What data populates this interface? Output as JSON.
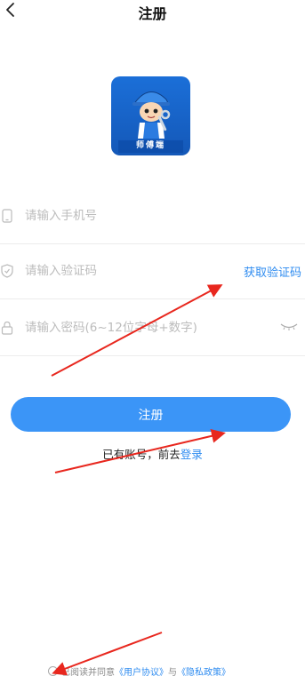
{
  "header": {
    "title": "注册",
    "back_icon": "chevron-left-icon"
  },
  "logo": {
    "label": "师傅端",
    "icon": "mechanic-mascot-icon",
    "background": "#1b6fd8"
  },
  "form": {
    "phone_placeholder": "请输入手机号",
    "code_placeholder": "请输入验证码",
    "get_code_label": "获取验证码",
    "password_placeholder": "请输入密码(6~12位字母+数字)",
    "phone_icon": "phone-icon",
    "shield_icon": "shield-icon",
    "lock_icon": "lock-icon",
    "eye_icon": "eye-closed-icon"
  },
  "submit_label": "注册",
  "login_prompt": "已有账号，前去",
  "login_link": "登录",
  "agreement": {
    "prefix": "已阅读并同意",
    "user_agreement": "《用户协议》",
    "conjunction": "与",
    "privacy_policy": "《隐私政策》"
  },
  "colors": {
    "accent": "#2f8cf0",
    "button": "#3b95f7",
    "annotation": "#e8271e"
  }
}
